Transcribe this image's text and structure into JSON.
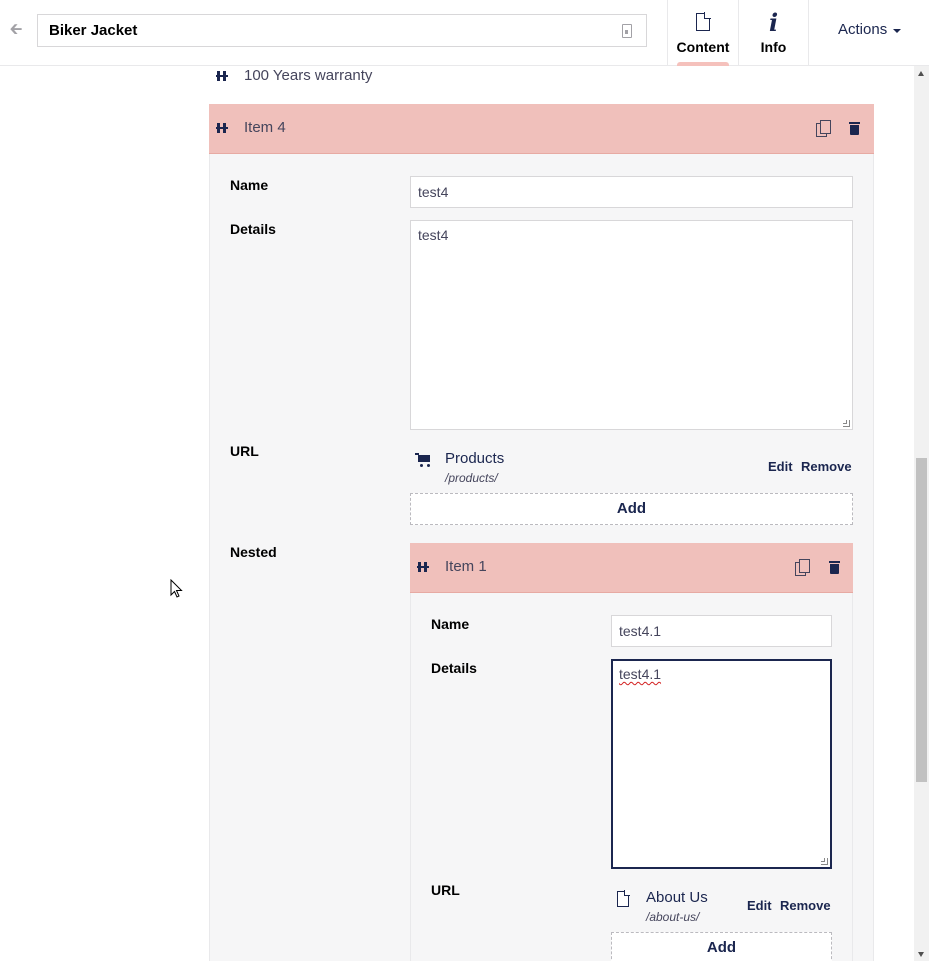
{
  "header": {
    "title_value": "Biker Jacket",
    "tabs": [
      {
        "label": "Content",
        "icon": "document-icon",
        "active": true
      },
      {
        "label": "Info",
        "icon": "info-icon",
        "active": false
      }
    ],
    "actions_label": "Actions"
  },
  "content": {
    "prev_item_title": "100 Years warranty",
    "item": {
      "title": "Item 4",
      "name_label": "Name",
      "name_value": "test4",
      "details_label": "Details",
      "details_value": "test4",
      "url_label": "URL",
      "url_link": {
        "name": "Products",
        "path": "/products/",
        "icon": "cart-icon"
      },
      "edit_label": "Edit",
      "remove_label": "Remove",
      "add_label": "Add",
      "nested_label": "Nested",
      "nested_item": {
        "title": "Item 1",
        "name_label": "Name",
        "name_value": "test4.1",
        "details_label": "Details",
        "details_value": "test4.1",
        "url_label": "URL",
        "url_link": {
          "name": "About Us",
          "path": "/about-us/",
          "icon": "document-icon"
        },
        "edit_label": "Edit",
        "remove_label": "Remove",
        "add_label": "Add"
      }
    }
  },
  "colors": {
    "brand": "#1b264f",
    "block_header": "#f0c0bb",
    "tab_indicator": "#f5c1bc"
  }
}
